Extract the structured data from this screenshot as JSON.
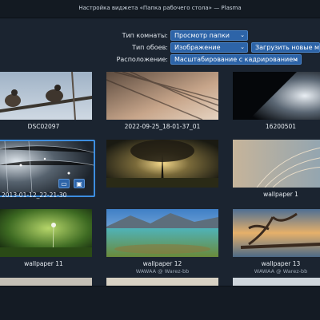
{
  "window": {
    "title": "Настройка виджета «Папка рабочего стола» — Plasma"
  },
  "settings": {
    "room_type_label": "Тип комнаты:",
    "room_type_value": "Просмотр папки",
    "wallpaper_type_label": "Тип обоев:",
    "wallpaper_type_value": "Изображение",
    "download_button": "Загрузить новые мод",
    "position_label": "Расположение:",
    "position_value": "Масштабирование с кадрированием"
  },
  "wallpapers": [
    {
      "name": "DSC02097",
      "author": ""
    },
    {
      "name": "2022-09-25_18-01-37_01",
      "author": ""
    },
    {
      "name": "16200501",
      "author": ""
    },
    {
      "name": "2013-01-12_22-21-30",
      "author": ""
    },
    {
      "name": "",
      "author": ""
    },
    {
      "name": "wallpaper 1",
      "author": ""
    },
    {
      "name": "wallpaper 11",
      "author": ""
    },
    {
      "name": "wallpaper 12",
      "author": "WAWAA @ Warez-bb"
    },
    {
      "name": "wallpaper 13",
      "author": "WAWAA @ Warez-bb"
    }
  ],
  "icons": {
    "dropdown": "chevron-down-icon",
    "open_folder": "folder-icon",
    "delete": "trash-icon"
  },
  "colors": {
    "accent": "#2d64a8",
    "background": "#1b2430",
    "selection": "#3d8ee0"
  }
}
